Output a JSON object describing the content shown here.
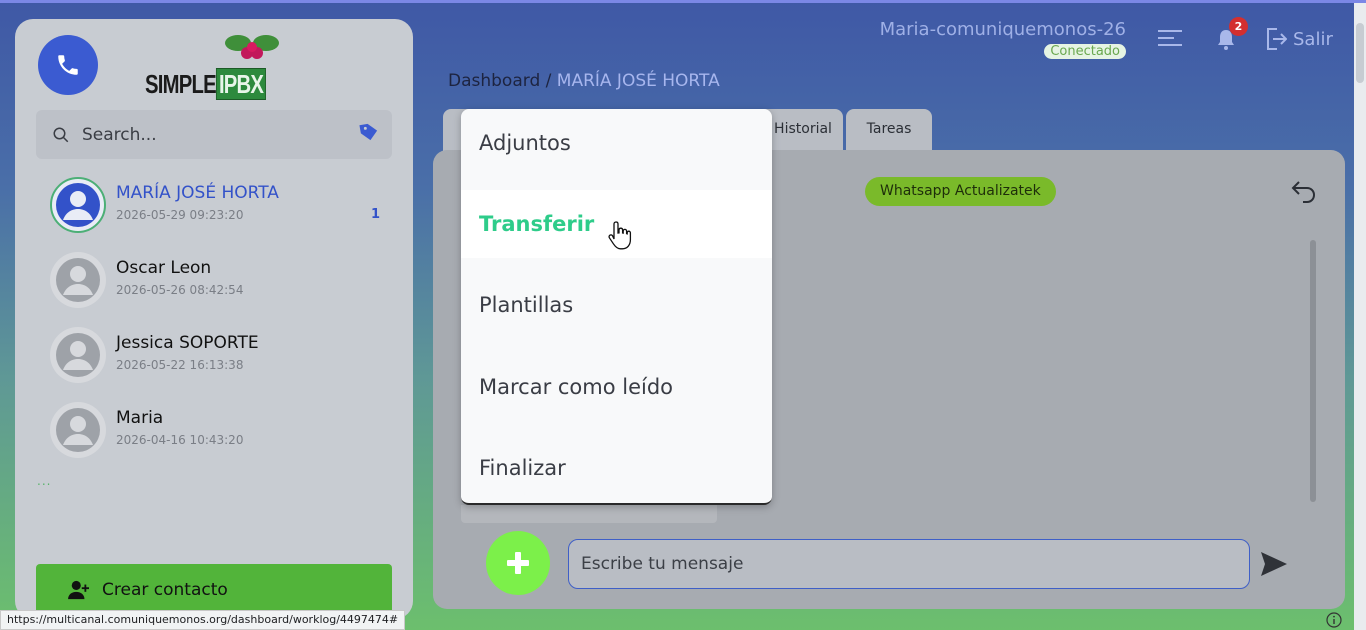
{
  "sidebar": {
    "logo": {
      "text_left": "SIMPLE",
      "text_right": "IPBX"
    },
    "search": {
      "placeholder": "Search..."
    },
    "contacts": [
      {
        "name": "MARÍA JOSÉ HORTA",
        "datetime": "2026-05-29 09:23:20",
        "unread": "1",
        "active": true
      },
      {
        "name": "Oscar Leon",
        "datetime": "2026-05-26 08:42:54"
      },
      {
        "name": "Jessica SOPORTE",
        "datetime": "2026-05-22 16:13:38"
      },
      {
        "name": "Maria",
        "datetime": "2026-04-16 10:43:20"
      }
    ],
    "more": "...",
    "create_contact_label": "Crear contacto"
  },
  "header": {
    "username": "Maria-comuniquemonos-26",
    "status": "Conectado",
    "notification_count": "2",
    "logout_label": "Salir"
  },
  "breadcrumb": {
    "root": "Dashboard",
    "separator": " / ",
    "current": "MARÍA JOSÉ HORTA"
  },
  "tabs": [
    {
      "label": "Historial"
    },
    {
      "label": "Tareas"
    }
  ],
  "chat": {
    "channel_badge": "Whatsapp Actualizatek",
    "message_placeholder": "Escribe tu mensaje"
  },
  "menu": {
    "items": [
      {
        "label": "Adjuntos"
      },
      {
        "label": "Transferir",
        "hovered": true
      },
      {
        "label": "Plantillas"
      },
      {
        "label": "Marcar como leído"
      },
      {
        "label": "Finalizar"
      }
    ]
  },
  "status_url": "https://multicanal.comuniquemonos.org/dashboard/worklog/4497474#",
  "colors": {
    "accent_blue": "#3b5bd1",
    "accent_green": "#52b43a",
    "hover_green": "#2ecc8a",
    "add_button": "#7cf04a",
    "notification_red": "#d32f2f"
  },
  "icons": [
    "phone-icon",
    "search-icon",
    "tag-icon",
    "user-avatar-icon",
    "user-plus-icon",
    "menu-lines-icon",
    "bell-icon",
    "logout-icon",
    "undo-icon",
    "plus-icon",
    "send-icon",
    "info-icon",
    "hand-cursor-icon"
  ]
}
